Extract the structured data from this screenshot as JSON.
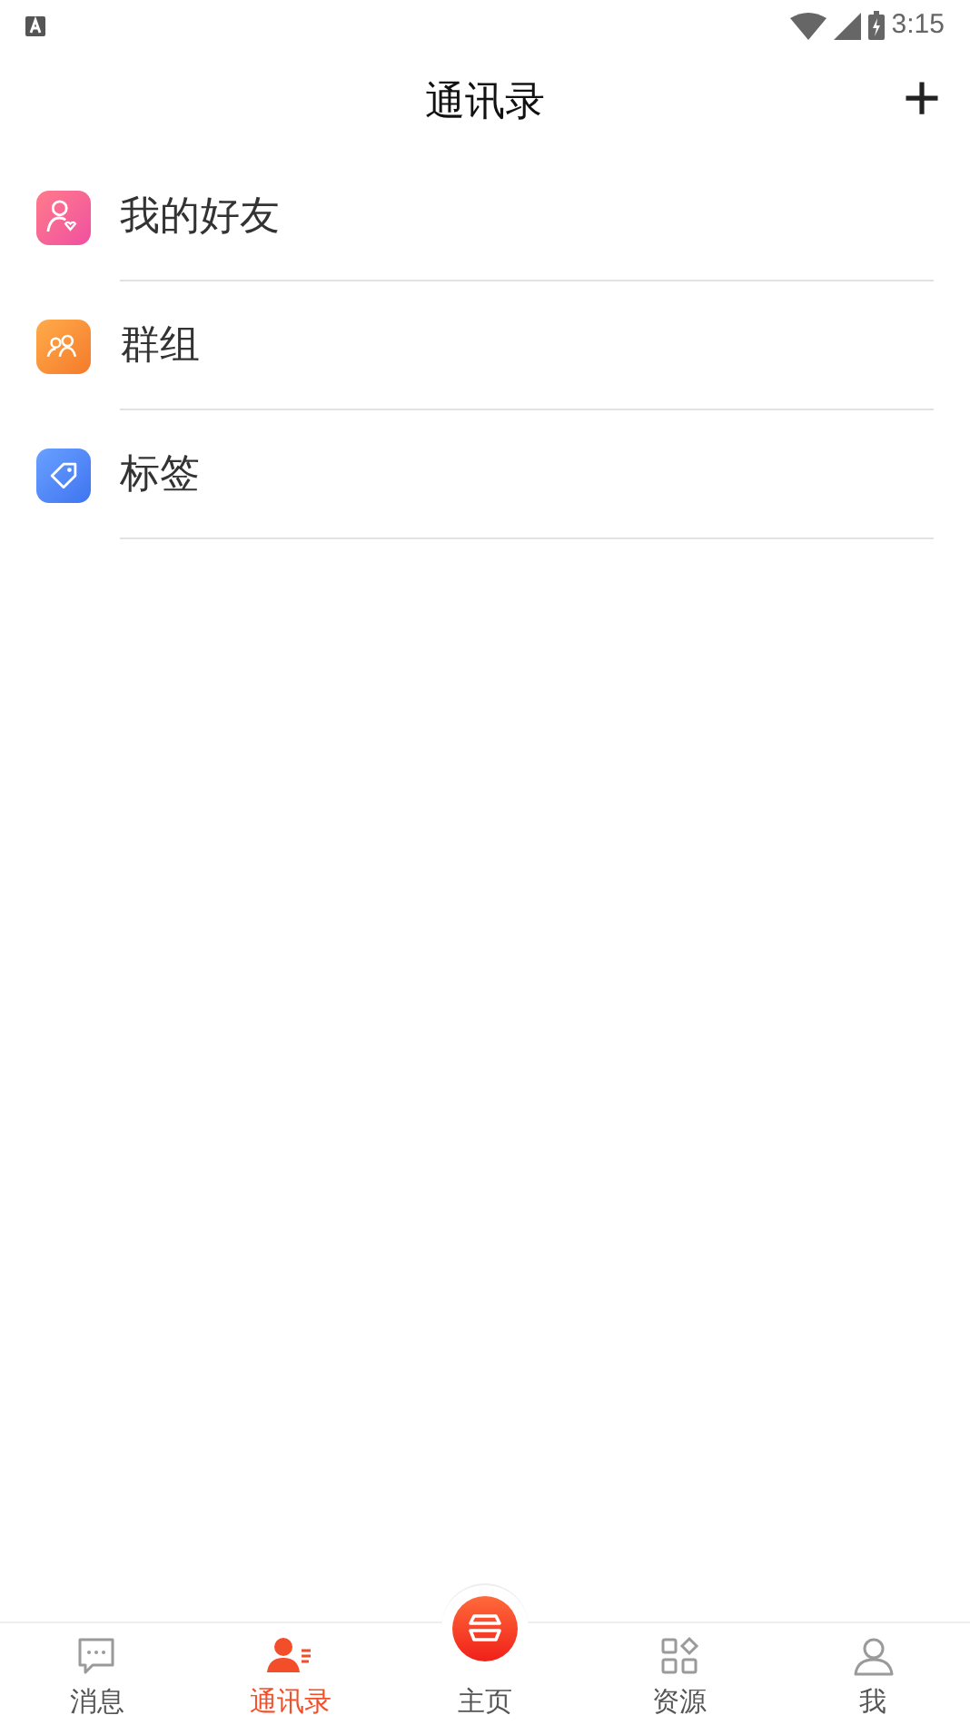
{
  "status_bar": {
    "time": "3:15"
  },
  "header": {
    "title": "通讯录",
    "add_button": "+"
  },
  "items": [
    {
      "label": "我的好友",
      "kind": "friends"
    },
    {
      "label": "群组",
      "kind": "groups"
    },
    {
      "label": "标签",
      "kind": "tags"
    }
  ],
  "tabs": [
    {
      "label": "消息",
      "kind": "messages",
      "selected": false
    },
    {
      "label": "通讯录",
      "kind": "contacts",
      "selected": true
    },
    {
      "label": "主页",
      "kind": "home",
      "selected": false
    },
    {
      "label": "资源",
      "kind": "resources",
      "selected": false
    },
    {
      "label": "我",
      "kind": "me",
      "selected": false
    }
  ]
}
